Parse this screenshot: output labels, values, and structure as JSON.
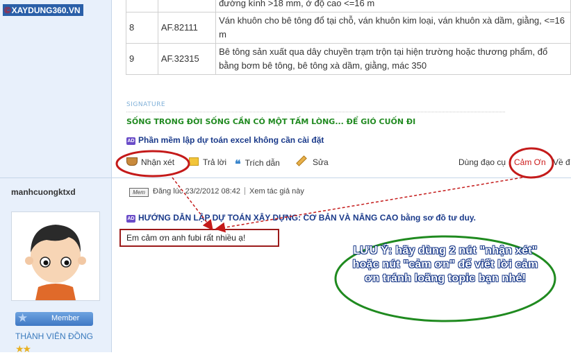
{
  "logo": {
    "symbol": "©",
    "text": "XAYDUNG360.VN"
  },
  "table_rows": [
    {
      "num": "",
      "code": "",
      "desc": "đường kính >18 mm, ở độ cao <=16 m"
    },
    {
      "num": "8",
      "code": "AF.82111",
      "desc": "Ván  khuôn cho bê tông đổ tại chỗ, ván khuôn kim loại, ván khuôn xà dầm, giằng, <=16 m"
    },
    {
      "num": "9",
      "code": "AF.32315",
      "desc": "Bê  tông sản xuất qua dây chuyền trạm trộn tại hiện trường hoặc thương phẩm, đổ  bằng bơm bê tông, bê tông xà dầm, giằng, mác 350"
    }
  ],
  "post1": {
    "signature_label": "SIGNATURE",
    "signature_text": "SỐNG TRONG ĐỜI SỐNG CẦN CÓ MỘT TẤM LÒNG... ĐỂ GIÓ CUỐN ĐI",
    "ad_badge": "AD",
    "ad_link": "Phần mềm lập dự toán excel không cần cài đặt",
    "actions": {
      "comment": "Nhận xét",
      "reply": "Trả lời",
      "quote": "Trích dẫn",
      "edit": "Sửa",
      "tools": "Dùng đạo cụ",
      "thanks": "Cảm Ơn",
      "more": "Về đ"
    }
  },
  "post2": {
    "username": "manhcuongktxd",
    "rank_badge": "Member",
    "rank_title": "THÀNH VIÊN ĐỒNG",
    "rank_stars": "★★",
    "mem_icon": "Mem",
    "posted_at": "Đăng lúc 23/2/2012 08:42",
    "view_author": "Xem tác giả này",
    "ad_badge": "AD",
    "ad_link": "HƯỚNG DẪN LẬP DỰ TOÁN XÂY DỰNG: CƠ BẢN VÀ NÂNG CAO bằng sơ đồ tư duy.",
    "message": "Em cảm ơn anh fubi rất nhiều ạ!"
  },
  "annotation": {
    "note": "LƯU Ý: hãy dùng 2 nút \"nhận xét\" hoặc nút \"cảm ơn\" để viết lời cảm ơn tránh loãng topic bạn nhé!"
  },
  "colors": {
    "annotation_red": "#c41a1a",
    "annotation_green": "#1f8a1f",
    "annotation_blue_text": "#1a3a8a",
    "signature_green": "#228b22",
    "link_blue": "#1a3a8a"
  }
}
